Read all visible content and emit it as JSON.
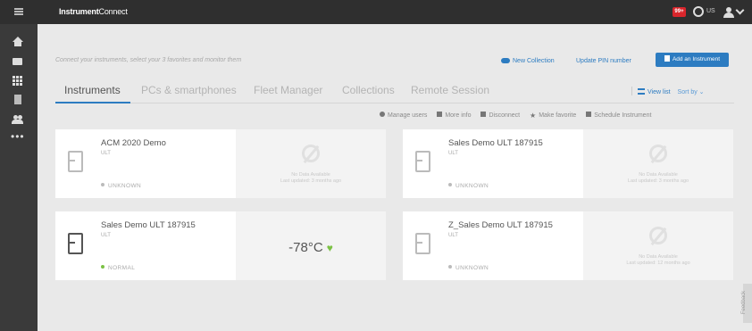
{
  "header": {
    "brand_bold": "Instrument",
    "brand_light": "Connect",
    "notification_badge": "99+",
    "language": "US"
  },
  "sidebar": {
    "items": [
      {
        "icon": "home-icon"
      },
      {
        "icon": "folder-icon"
      },
      {
        "icon": "grid-icon"
      },
      {
        "icon": "document-icon"
      },
      {
        "icon": "users-icon"
      },
      {
        "icon": "more-icon",
        "label": "•••"
      }
    ]
  },
  "intro_text": "Connect your instruments, select your 3 favorites and monitor them",
  "toolbar": {
    "new_collection": "New Collection",
    "update_pin": "Update PIN number",
    "add_instrument": "Add an Instrument"
  },
  "tabs": [
    "Instruments",
    "PCs & smartphones",
    "Fleet Manager",
    "Collections",
    "Remote Session"
  ],
  "view": {
    "view_list": "View list",
    "sort_by": "Sort by ⌄"
  },
  "actions": {
    "manage_users": "Manage users",
    "more_info": "More info",
    "disconnect": "Disconnect",
    "make_favorite": "Make favorite",
    "schedule": "Schedule Instrument"
  },
  "cards": [
    {
      "title": "ACM 2020 Demo",
      "type": "ULT",
      "status": "UNKNOWN",
      "no_data": "No Data Available",
      "last_update": "Last updated: 3 months ago"
    },
    {
      "title": "Sales Demo ULT 187915",
      "type": "ULT",
      "status": "UNKNOWN",
      "no_data": "No Data Available",
      "last_update": "Last updated: 3 months ago"
    },
    {
      "title": "Sales Demo ULT 187915",
      "type": "ULT",
      "status": "NORMAL",
      "temperature": "-78°C"
    },
    {
      "title": "Z_Sales Demo ULT 187915",
      "type": "ULT",
      "status": "UNKNOWN",
      "no_data": "No Data Available",
      "last_update": "Last updated: 12 months ago"
    }
  ],
  "feedback": "Feedback",
  "colors": {
    "accent": "#2d7cc1",
    "topbar": "#2f2f2f",
    "sidebar": "#3a3a3a",
    "normal": "#7bc144",
    "alert": "#d9262c"
  }
}
